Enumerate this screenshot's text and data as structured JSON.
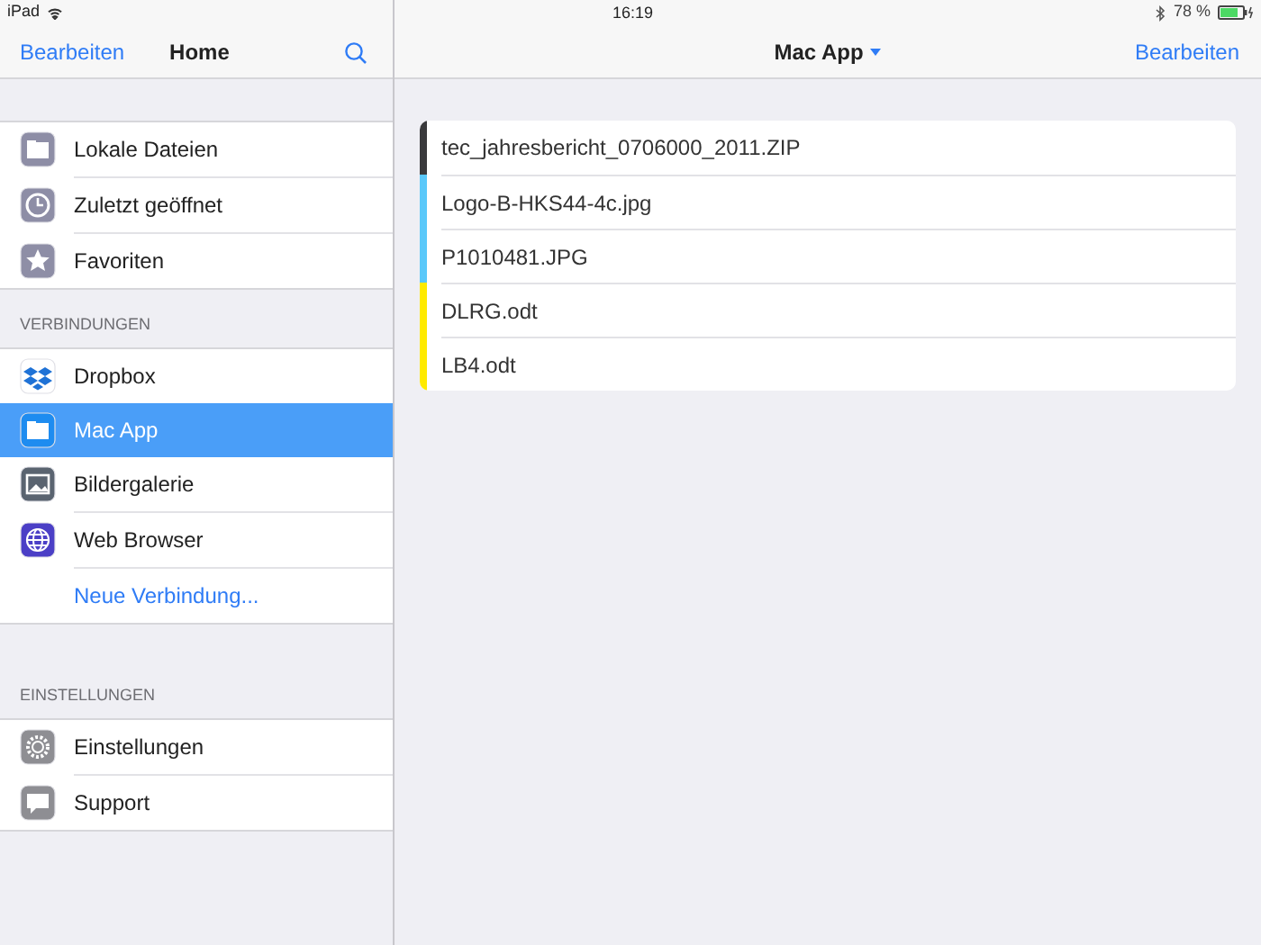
{
  "status_bar": {
    "device": "iPad",
    "time": "16:19",
    "battery": "78 %"
  },
  "sidebar": {
    "edit_button": "Bearbeiten",
    "title": "Home",
    "sections": [
      {
        "items": [
          {
            "kind": "item",
            "label": "Lokale Dateien",
            "selected": false
          },
          {
            "kind": "item",
            "label": "Zuletzt geöffnet",
            "selected": false
          },
          {
            "kind": "item",
            "label": "Favoriten",
            "selected": false
          }
        ]
      },
      {
        "header": "VERBINDUNGEN",
        "items": [
          {
            "kind": "item",
            "label": "Dropbox",
            "selected": false
          },
          {
            "kind": "item",
            "label": "Mac App",
            "selected": true
          },
          {
            "kind": "item",
            "label": "Bildergalerie",
            "selected": false
          },
          {
            "kind": "item",
            "label": "Web Browser",
            "selected": false
          },
          {
            "kind": "link",
            "label": "Neue Verbindung...",
            "selected": false
          }
        ]
      },
      {
        "header": "EINSTELLUNGEN",
        "items": [
          {
            "kind": "item",
            "label": "Einstellungen",
            "selected": false
          },
          {
            "kind": "item",
            "label": "Support",
            "selected": false
          }
        ]
      }
    ]
  },
  "main": {
    "title": "Mac App",
    "edit_button": "Bearbeiten",
    "files": [
      {
        "name": "tec_jahresbericht_0706000_2011.ZIP",
        "color": "#3a3a3c"
      },
      {
        "name": "Logo-B-HKS44-4c.jpg",
        "color": "#5ac8fa"
      },
      {
        "name": "P1010481.JPG",
        "color": "#5ac8fa"
      },
      {
        "name": "DLRG.odt",
        "color": "#ffea00"
      },
      {
        "name": "LB4.odt",
        "color": "#ffea00"
      }
    ]
  }
}
